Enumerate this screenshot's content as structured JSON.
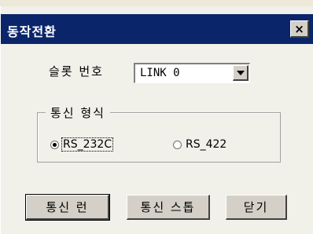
{
  "window": {
    "title": "동작전환",
    "close_glyph": "×"
  },
  "slot": {
    "label": "슬롯 번호",
    "value": "LINK 0"
  },
  "comm": {
    "group_title": "통신 형식",
    "options": [
      {
        "label": "RS_232C",
        "selected": true
      },
      {
        "label": "RS_422",
        "selected": false
      }
    ]
  },
  "buttons": {
    "run": "통신 런",
    "stop": "통신 스톱",
    "close": "닫기"
  }
}
